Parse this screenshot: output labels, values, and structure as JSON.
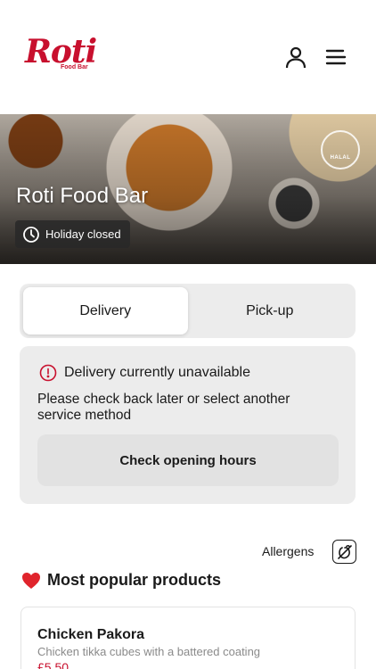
{
  "header": {
    "logo_text": "Roti",
    "logo_subtext": "Food Bar",
    "icons": {
      "account": "user-icon",
      "menu": "hamburger-menu-icon"
    }
  },
  "hero": {
    "restaurant_name": "Roti Food Bar",
    "status_text": "Holiday closed",
    "badge_text": "HALAL"
  },
  "service_toggle": {
    "tabs": [
      {
        "label": "Delivery",
        "active": true
      },
      {
        "label": "Pick-up",
        "active": false
      }
    ]
  },
  "notice": {
    "title": "Delivery currently unavailable",
    "message": "Please check back later or select another service method",
    "button_label": "Check opening hours"
  },
  "allergens": {
    "label": "Allergens"
  },
  "popular": {
    "title": "Most popular products",
    "products": [
      {
        "name": "Chicken Pakora",
        "description": "Chicken tikka cubes with a battered coating",
        "price": "£5.50"
      }
    ]
  },
  "colors": {
    "brand": "#c8102e",
    "surface": "#ececec",
    "text": "#1a1a1a"
  }
}
